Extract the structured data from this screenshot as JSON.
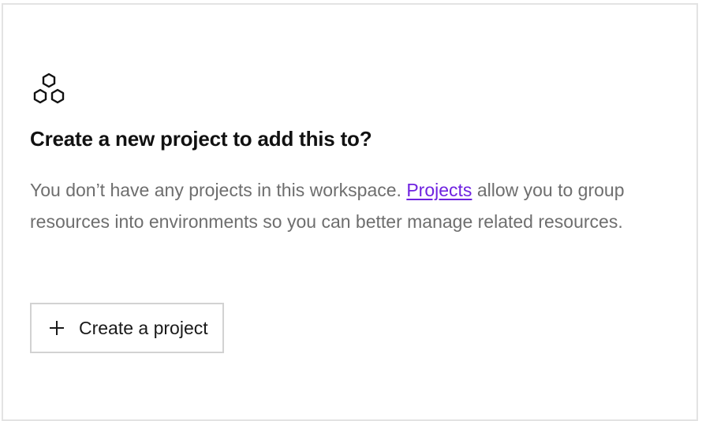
{
  "empty_state": {
    "icon": "hexagons-cluster-icon",
    "title": "Create a new project to add this to?",
    "description_before": "You don’t have any projects in this workspace.",
    "description_link": "Projects",
    "description_after": "allow you to group resources into environments so you can better manage related resources.",
    "button": {
      "icon": "plus-icon",
      "label": "Create a project"
    }
  },
  "colors": {
    "link": "#6f22e0",
    "title": "#111111",
    "description": "#6e6e6e",
    "border": "#e3e3e3"
  }
}
